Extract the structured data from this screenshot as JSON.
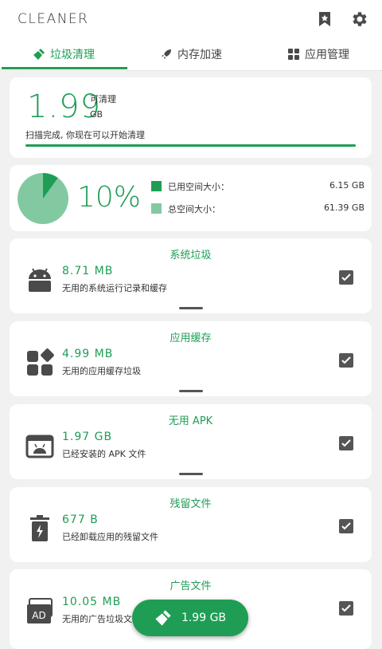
{
  "app": {
    "title": "CLEANER"
  },
  "tabs": [
    {
      "label": "垃圾清理",
      "icon": "broom-icon",
      "active": true
    },
    {
      "label": "内存加速",
      "icon": "rocket-icon",
      "active": false
    },
    {
      "label": "应用管理",
      "icon": "apps-icon",
      "active": false
    }
  ],
  "summary": {
    "amount": "1.99",
    "cleanable_label": "可清理",
    "unit": "GB",
    "status": "扫描完成, 你现在可以开始清理",
    "progress": 1.0
  },
  "storage": {
    "percent_label": "10%",
    "used_fraction": 0.1,
    "used_label": "已用空间大小：",
    "used_value": "6.15 GB",
    "total_label": "总空间大小：",
    "total_value": "61.39 GB",
    "used_color": "#1f9d55",
    "total_color": "#82c9a2"
  },
  "categories": [
    {
      "title": "系统垃圾",
      "size": "8.71 MB",
      "desc": "无用的系统运行记录和缓存",
      "icon": "android-icon",
      "checked": true
    },
    {
      "title": "应用缓存",
      "size": "4.99 MB",
      "desc": "无用的应用缓存垃圾",
      "icon": "app-cache-icon",
      "checked": true
    },
    {
      "title": "无用 APK",
      "size": "1.97 GB",
      "desc": "已经安装的 APK 文件",
      "icon": "apk-icon",
      "checked": true
    },
    {
      "title": "残留文件",
      "size": "677 B",
      "desc": "已经卸载应用的残留文件",
      "icon": "residual-trash-icon",
      "checked": true
    },
    {
      "title": "广告文件",
      "size": "10.05 MB",
      "desc": "无用的广告垃圾文件",
      "icon": "ad-icon",
      "checked": true
    }
  ],
  "fab": {
    "label": "1.99 GB",
    "icon": "broom-icon"
  }
}
